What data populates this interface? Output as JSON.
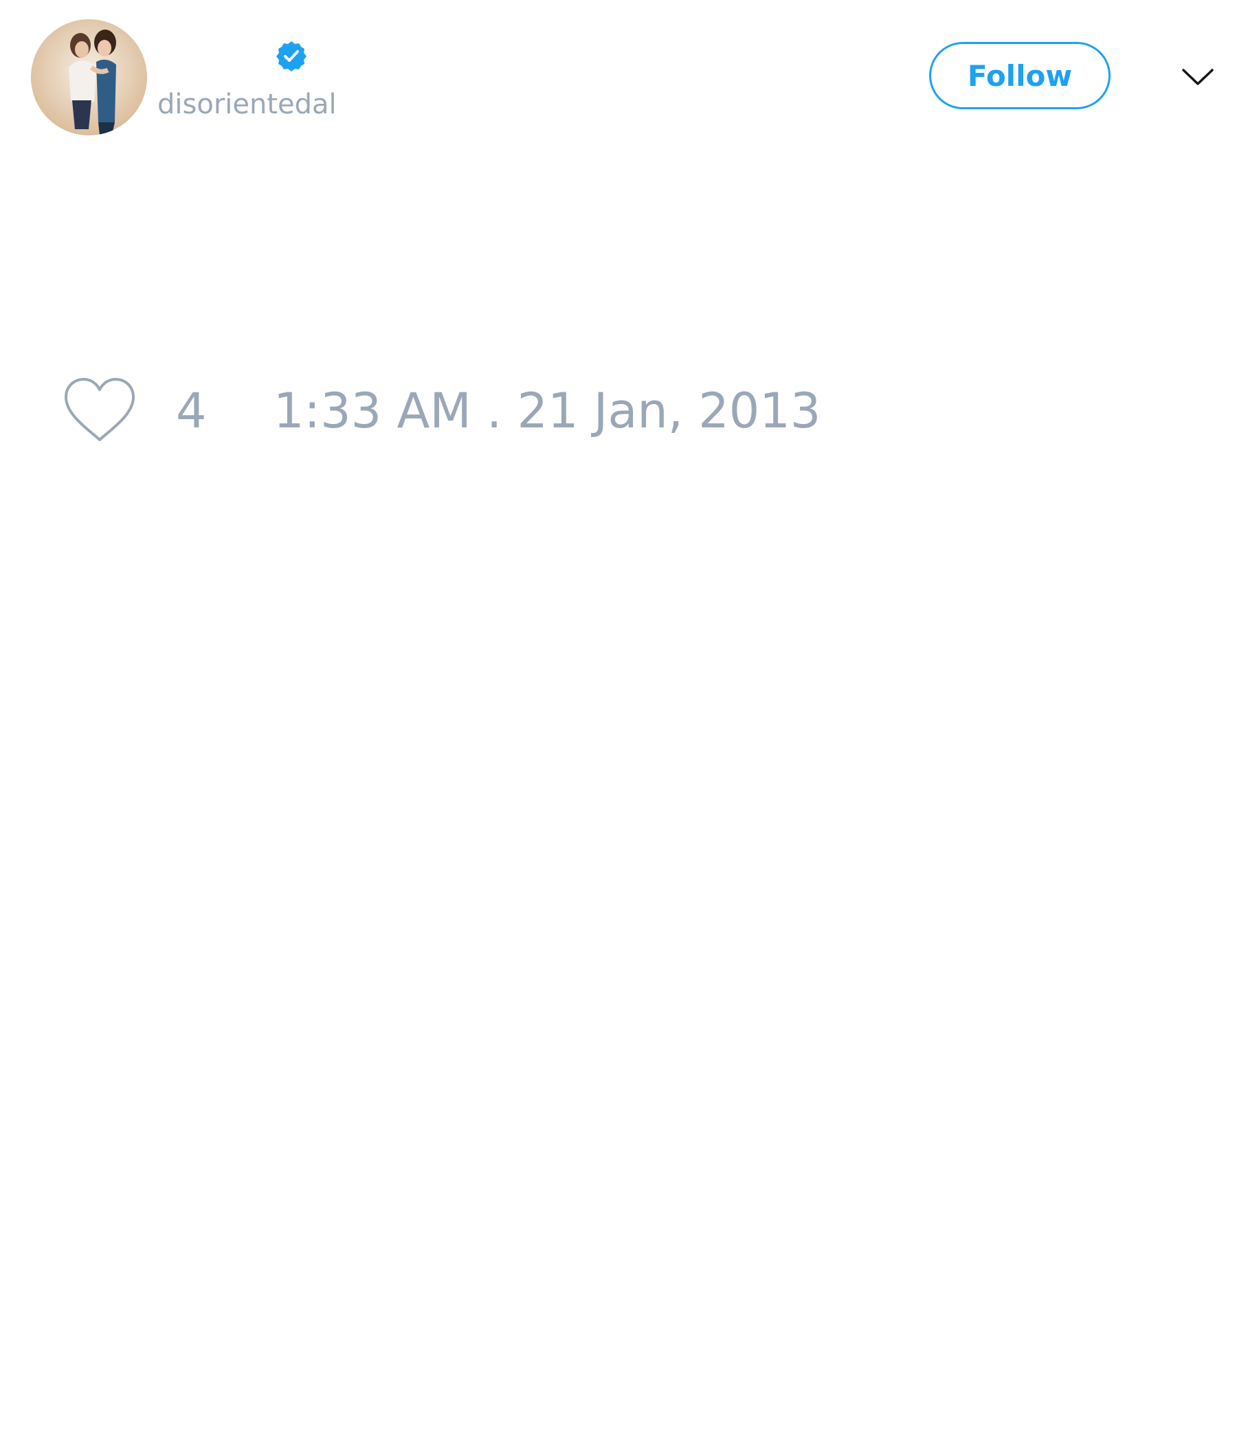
{
  "tweet": {
    "author": {
      "display_name": "",
      "handle": "disorientedal",
      "verified": true,
      "avatar_icon": "profile-photo"
    },
    "follow_button_label": "Follow",
    "menu_icon": "chevron-down-icon",
    "likes": {
      "icon": "heart-outline-icon",
      "count": "4"
    },
    "timestamp": "1:33 AM . 21 Jan, 2013"
  },
  "colors": {
    "accent": "#1da1f2",
    "muted_text": "#9aa7b8",
    "background": "#ffffff"
  }
}
